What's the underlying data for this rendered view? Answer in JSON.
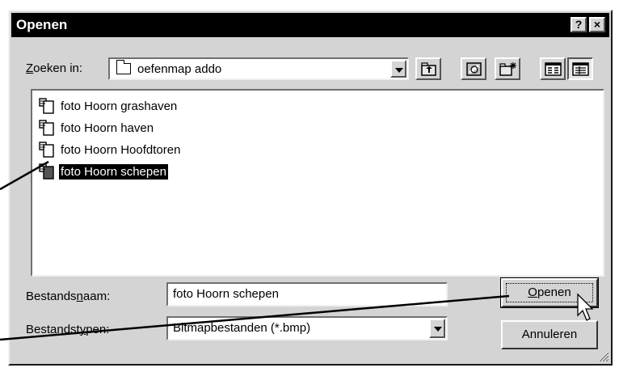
{
  "window": {
    "title": "Openen",
    "help_label": "?",
    "close_label": "×"
  },
  "lookin": {
    "label_prefix": "Z",
    "label_rest": "oeken in:",
    "value": "oefenmap addo",
    "icon": "folder-icon"
  },
  "toolbar": {
    "icons": [
      "up-folder-icon",
      "desktop-icon",
      "new-folder-icon",
      "list-view-icon",
      "details-view-icon"
    ]
  },
  "files": [
    {
      "name": "foto Hoorn grashaven",
      "selected": false
    },
    {
      "name": "foto Hoorn haven",
      "selected": false
    },
    {
      "name": "foto Hoorn Hoofdtoren",
      "selected": false
    },
    {
      "name": "foto Hoorn schepen",
      "selected": true
    }
  ],
  "filename": {
    "label_before": "Bestands",
    "label_underlined": "n",
    "label_after": "aam:",
    "value": "foto Hoorn schepen"
  },
  "filetype": {
    "label_before": "Bestandst",
    "label_underlined": "y",
    "label_after": "pen:",
    "value": "Bitmapbestanden (*.bmp)"
  },
  "buttons": {
    "open_underlined": "O",
    "open_rest": "penen",
    "cancel": "Annuleren"
  },
  "colors": {
    "dialog_bg": "#d4d4d4",
    "titlebar_bg": "#000000",
    "selection_bg": "#000000"
  }
}
